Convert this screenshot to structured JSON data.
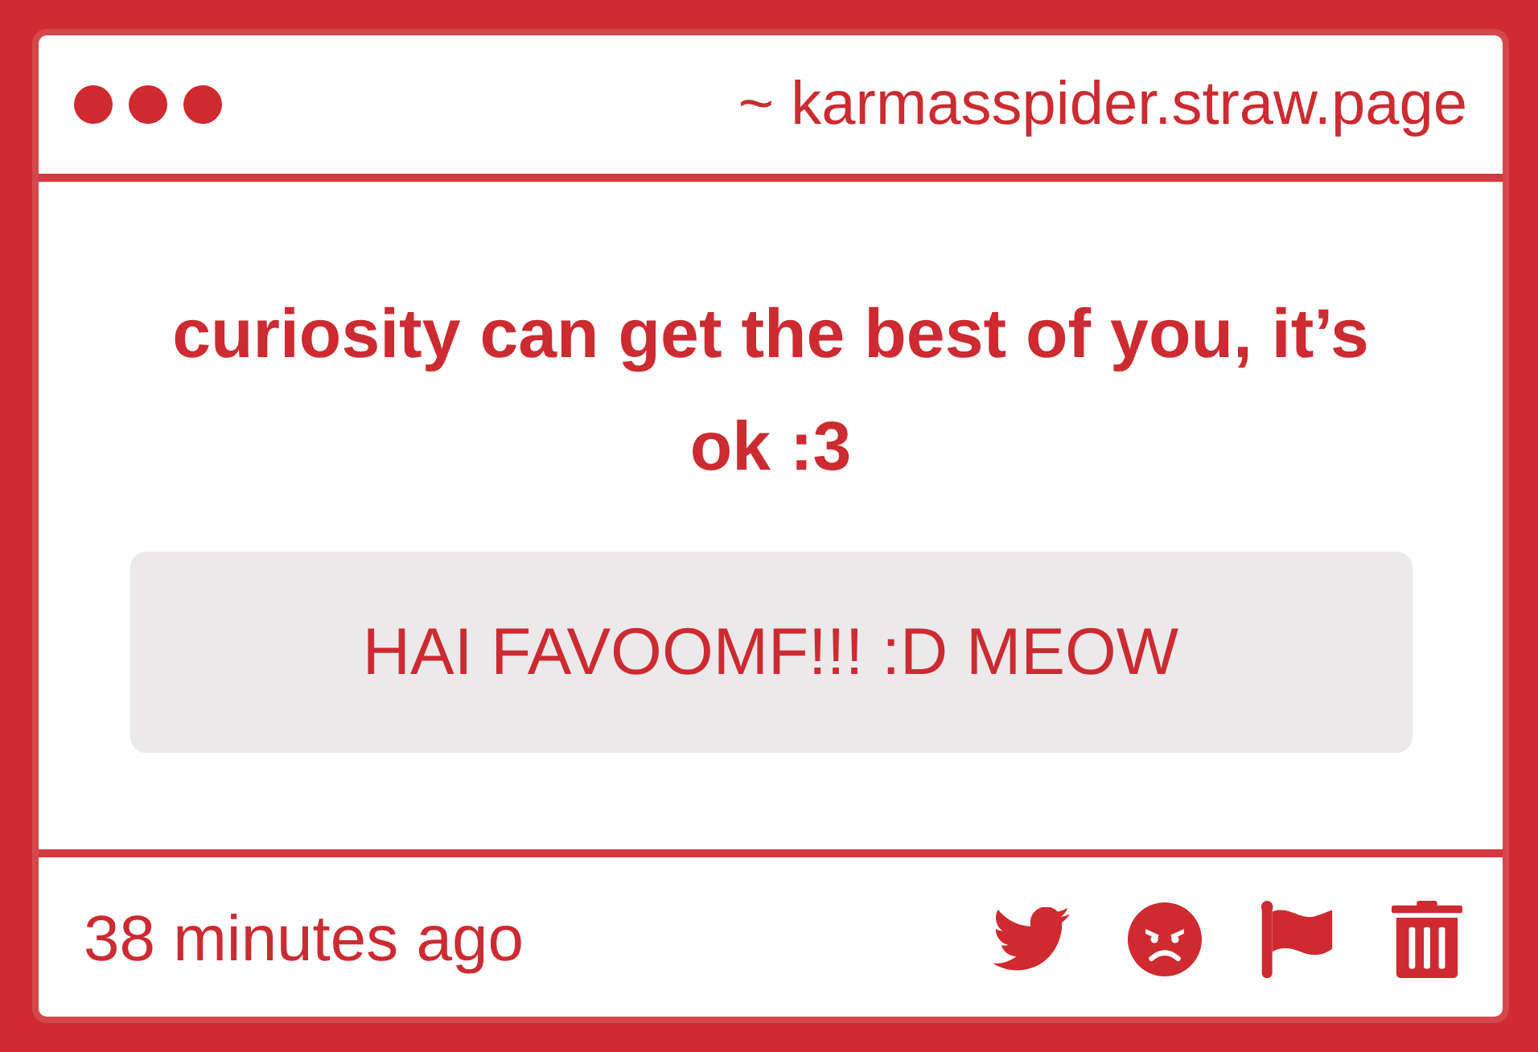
{
  "window": {
    "url": "~ karmasspider.straw.page"
  },
  "question": {
    "text": "curiosity can get the best of you, it’s ok :3"
  },
  "answer": {
    "text": "HAI FAVOOMF!!! :D MEOW"
  },
  "footer": {
    "time": "38 minutes ago",
    "actions": [
      {
        "kind": "bird"
      },
      {
        "kind": "angry"
      },
      {
        "kind": "flag"
      },
      {
        "kind": "trash"
      }
    ]
  }
}
